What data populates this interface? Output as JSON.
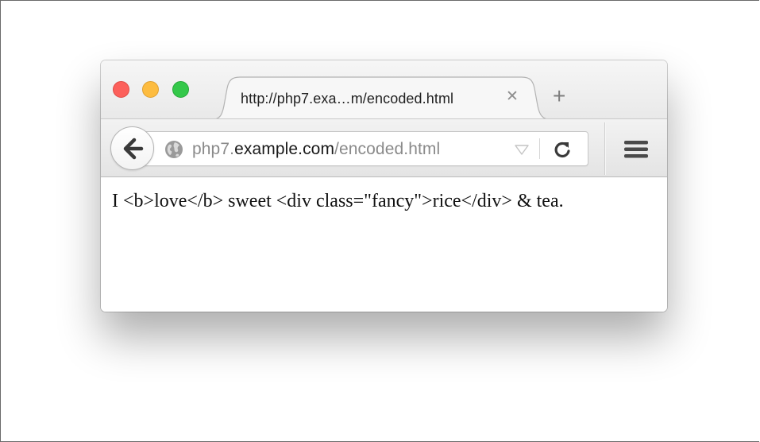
{
  "tab": {
    "title": "http://php7.exa…m/encoded.html",
    "close_glyph": "✕",
    "new_tab_glyph": "+"
  },
  "url_bar": {
    "prefix": "php7.",
    "domain": "example.com",
    "path": "/encoded.html"
  },
  "icons": {
    "back": "back-arrow-icon",
    "site": "globe-icon",
    "dropmarker": "dropdown-triangle-icon",
    "reload": "reload-icon",
    "menu": "hamburger-menu-icon"
  },
  "content": {
    "text": "I <b>love</b> sweet <div class=\"fancy\">rice</div> & tea."
  },
  "colors": {
    "close": "#fc605b",
    "minimize": "#fdbc40",
    "maximize": "#34c84a"
  }
}
